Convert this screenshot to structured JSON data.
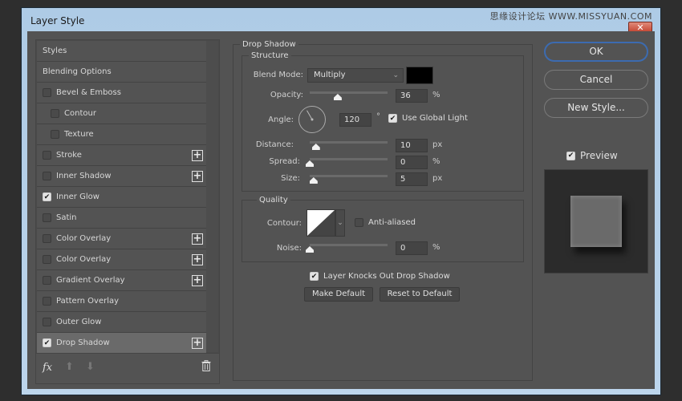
{
  "window": {
    "title": "Layer Style",
    "watermark": "思缘设计论坛 WWW.MISSYUAN.COM",
    "close_glyph": "✕"
  },
  "styles_panel": {
    "items": [
      {
        "label": "Styles",
        "checkbox": null,
        "sub": false,
        "plus": false,
        "selected": false
      },
      {
        "label": "Blending Options",
        "checkbox": null,
        "sub": false,
        "plus": false,
        "selected": false
      },
      {
        "label": "Bevel & Emboss",
        "checkbox": false,
        "sub": false,
        "plus": false,
        "selected": false
      },
      {
        "label": "Contour",
        "checkbox": false,
        "sub": true,
        "plus": false,
        "selected": false
      },
      {
        "label": "Texture",
        "checkbox": false,
        "sub": true,
        "plus": false,
        "selected": false
      },
      {
        "label": "Stroke",
        "checkbox": false,
        "sub": false,
        "plus": true,
        "selected": false
      },
      {
        "label": "Inner Shadow",
        "checkbox": false,
        "sub": false,
        "plus": true,
        "selected": false
      },
      {
        "label": "Inner Glow",
        "checkbox": true,
        "sub": false,
        "plus": false,
        "selected": false
      },
      {
        "label": "Satin",
        "checkbox": false,
        "sub": false,
        "plus": false,
        "selected": false
      },
      {
        "label": "Color Overlay",
        "checkbox": false,
        "sub": false,
        "plus": true,
        "selected": false
      },
      {
        "label": "Color Overlay",
        "checkbox": false,
        "sub": false,
        "plus": true,
        "selected": false
      },
      {
        "label": "Gradient Overlay",
        "checkbox": false,
        "sub": false,
        "plus": true,
        "selected": false
      },
      {
        "label": "Pattern Overlay",
        "checkbox": false,
        "sub": false,
        "plus": false,
        "selected": false
      },
      {
        "label": "Outer Glow",
        "checkbox": false,
        "sub": false,
        "plus": false,
        "selected": false
      },
      {
        "label": "Drop Shadow",
        "checkbox": true,
        "sub": false,
        "plus": true,
        "selected": true
      }
    ],
    "footer": {
      "fx": "fx",
      "up": "⬆",
      "down": "⬇"
    }
  },
  "drop_shadow": {
    "title": "Drop Shadow",
    "structure": {
      "title": "Structure",
      "blend_mode_label": "Blend Mode:",
      "blend_mode_value": "Multiply",
      "shadow_color": "#000000",
      "opacity_label": "Opacity:",
      "opacity_value": "36",
      "opacity_unit": "%",
      "opacity_fraction": 0.36,
      "angle_label": "Angle:",
      "angle_value": "120",
      "angle_unit": "°",
      "angle_degrees": 120,
      "use_global_light_label": "Use Global Light",
      "use_global_light": true,
      "distance_label": "Distance:",
      "distance_value": "10",
      "distance_unit": "px",
      "distance_fraction": 0.08,
      "spread_label": "Spread:",
      "spread_value": "0",
      "spread_unit": "%",
      "spread_fraction": 0.0,
      "size_label": "Size:",
      "size_value": "5",
      "size_unit": "px",
      "size_fraction": 0.05
    },
    "quality": {
      "title": "Quality",
      "contour_label": "Contour:",
      "anti_aliased_label": "Anti-aliased",
      "anti_aliased": false,
      "noise_label": "Noise:",
      "noise_value": "0",
      "noise_unit": "%",
      "noise_fraction": 0.0
    },
    "knocks_out_label": "Layer Knocks Out Drop Shadow",
    "knocks_out": true,
    "make_default_label": "Make Default",
    "reset_default_label": "Reset to Default"
  },
  "actions": {
    "ok_label": "OK",
    "cancel_label": "Cancel",
    "new_style_label": "New Style...",
    "preview_label": "Preview",
    "preview_checked": true
  },
  "glyphs": {
    "check": "✔",
    "chevron": "⌄",
    "plus": "+"
  }
}
